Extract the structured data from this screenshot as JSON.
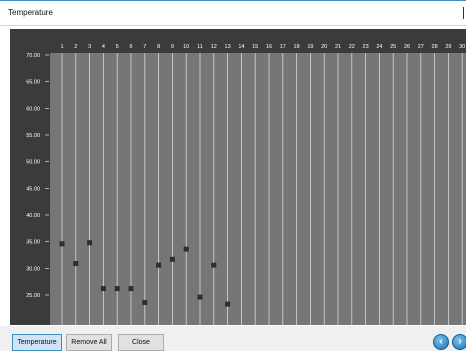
{
  "window": {
    "title": "Temperature"
  },
  "chart_data": {
    "type": "scatter",
    "x_ticks": [
      "1",
      "2",
      "3",
      "4",
      "5",
      "6",
      "7",
      "8",
      "9",
      "10",
      "11",
      "12",
      "13",
      "14",
      "15",
      "16",
      "17",
      "18",
      "19",
      "20",
      "21",
      "22",
      "23",
      "24",
      "25",
      "26",
      "27",
      "28",
      "29",
      "30"
    ],
    "y_ticks": [
      "70.00",
      "65.00",
      "60.00",
      "55.00",
      "50.00",
      "45.00",
      "40.00",
      "35.00",
      "30.00",
      "25.00"
    ],
    "ylim": [
      21,
      70
    ],
    "points": [
      {
        "x": 1,
        "y": 34.6
      },
      {
        "x": 2,
        "y": 30.9
      },
      {
        "x": 3,
        "y": 34.8
      },
      {
        "x": 4,
        "y": 26.2
      },
      {
        "x": 5,
        "y": 26.2
      },
      {
        "x": 6,
        "y": 26.2
      },
      {
        "x": 7,
        "y": 23.6
      },
      {
        "x": 8,
        "y": 30.6
      },
      {
        "x": 9,
        "y": 31.7
      },
      {
        "x": 10,
        "y": 33.6
      },
      {
        "x": 11,
        "y": 24.6
      },
      {
        "x": 12,
        "y": 30.6
      },
      {
        "x": 13,
        "y": 23.3
      }
    ],
    "colors": {
      "plot_bg": "#767676",
      "frame_bg": "#3b3b3b",
      "marker": "#2e2e2e",
      "grid": "#e8e8e8",
      "text": "#ffffff"
    }
  },
  "buttons": {
    "temperature": "Temperature",
    "remove_all": "Remove All",
    "close": "Close"
  },
  "nav": {
    "prev_icon": "arrow-left-icon",
    "next_icon": "arrow-right-icon"
  }
}
